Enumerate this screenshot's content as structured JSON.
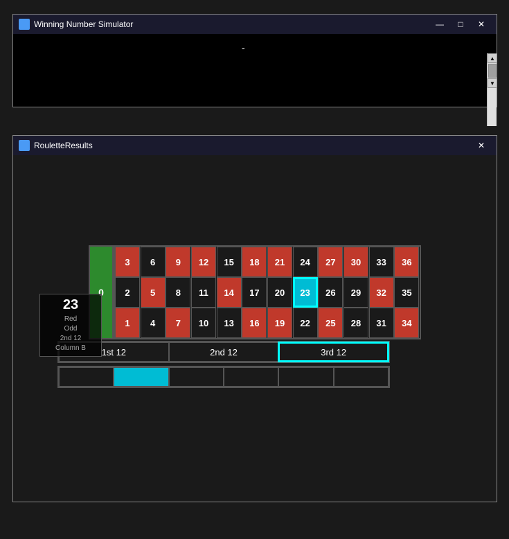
{
  "topWindow": {
    "title": "Winning Number Simulator",
    "iconColor": "#4a9af5",
    "cursorChar": "-",
    "controls": {
      "minimize": "—",
      "maximize": "□",
      "close": "✕"
    }
  },
  "bottomWindow": {
    "title": "RouletteResults",
    "controls": {
      "close": "✕"
    }
  },
  "roulette": {
    "zero": "0",
    "rows": [
      [
        {
          "n": "3",
          "color": "red"
        },
        {
          "n": "6",
          "color": "black"
        },
        {
          "n": "9",
          "color": "red"
        },
        {
          "n": "12",
          "color": "red"
        },
        {
          "n": "15",
          "color": "black"
        },
        {
          "n": "18",
          "color": "red"
        },
        {
          "n": "21",
          "color": "red"
        },
        {
          "n": "24",
          "color": "black"
        },
        {
          "n": "27",
          "color": "red"
        },
        {
          "n": "30",
          "color": "red"
        },
        {
          "n": "33",
          "color": "black"
        },
        {
          "n": "36",
          "color": "red"
        }
      ],
      [
        {
          "n": "2",
          "color": "black"
        },
        {
          "n": "5",
          "color": "red"
        },
        {
          "n": "8",
          "color": "black"
        },
        {
          "n": "11",
          "color": "black"
        },
        {
          "n": "14",
          "color": "red"
        },
        {
          "n": "17",
          "color": "black"
        },
        {
          "n": "20",
          "color": "black"
        },
        {
          "n": "23",
          "color": "cyan"
        },
        {
          "n": "26",
          "color": "black"
        },
        {
          "n": "29",
          "color": "black"
        },
        {
          "n": "32",
          "color": "red"
        },
        {
          "n": "35",
          "color": "black"
        }
      ],
      [
        {
          "n": "1",
          "color": "red"
        },
        {
          "n": "4",
          "color": "black"
        },
        {
          "n": "7",
          "color": "red"
        },
        {
          "n": "10",
          "color": "black"
        },
        {
          "n": "13",
          "color": "black"
        },
        {
          "n": "16",
          "color": "red"
        },
        {
          "n": "19",
          "color": "red"
        },
        {
          "n": "22",
          "color": "black"
        },
        {
          "n": "25",
          "color": "red"
        },
        {
          "n": "28",
          "color": "black"
        },
        {
          "n": "31",
          "color": "black"
        },
        {
          "n": "34",
          "color": "red"
        }
      ]
    ],
    "dozens": [
      "1st 12",
      "2nd 12",
      "3rd 12"
    ],
    "evenMoney": [
      "",
      "",
      "",
      "",
      "",
      ""
    ],
    "result": {
      "number": "23",
      "labels": [
        "Red",
        "Odd",
        "2nd 12",
        "Column B"
      ]
    }
  }
}
